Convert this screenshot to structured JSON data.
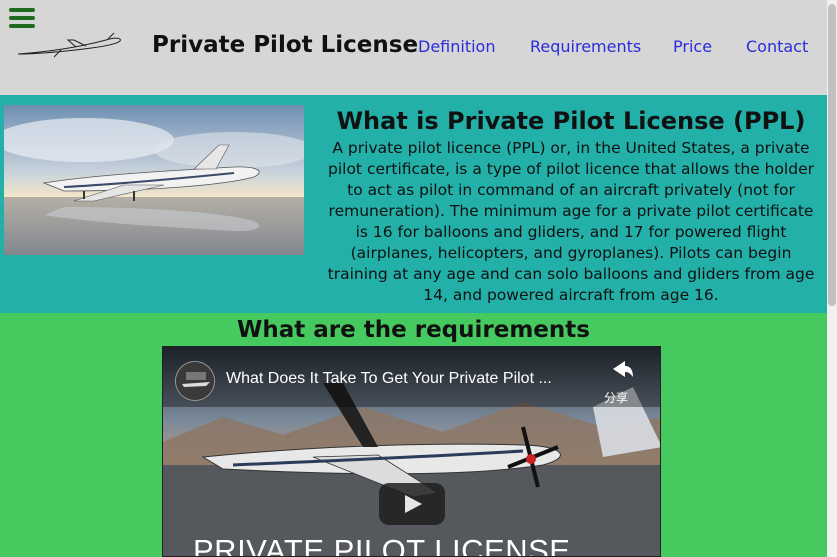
{
  "header": {
    "site_title": "Private Pilot License",
    "nav": [
      "Definition",
      "Requirements",
      "Price",
      "Contact"
    ]
  },
  "definition": {
    "title": "What is Private Pilot License (PPL)",
    "text": "A private pilot licence (PPL) or, in the United States, a private pilot certificate, is a type of pilot licence that allows the holder to act as pilot in command of an aircraft privately (not for remuneration). The minimum age for a private pilot certificate is 16 for balloons and gliders, and 17 for powered flight (airplanes, helicopters, and gyroplanes). Pilots can begin training at any age and can solo balloons and gliders from age 14, and powered aircraft from age 16."
  },
  "requirements": {
    "title": "What are the requirements",
    "video": {
      "title": "What Does It Take To Get Your Private Pilot ...",
      "share_label": "分享",
      "caption": "PRIVATE PILOT LICENSE"
    }
  },
  "colors": {
    "header_bg": "#d6d6d6",
    "definition_bg": "#22b0a8",
    "requirements_bg": "#46c95e",
    "nav_link": "#2b2bdc",
    "hamburger": "#1e6b1e"
  }
}
